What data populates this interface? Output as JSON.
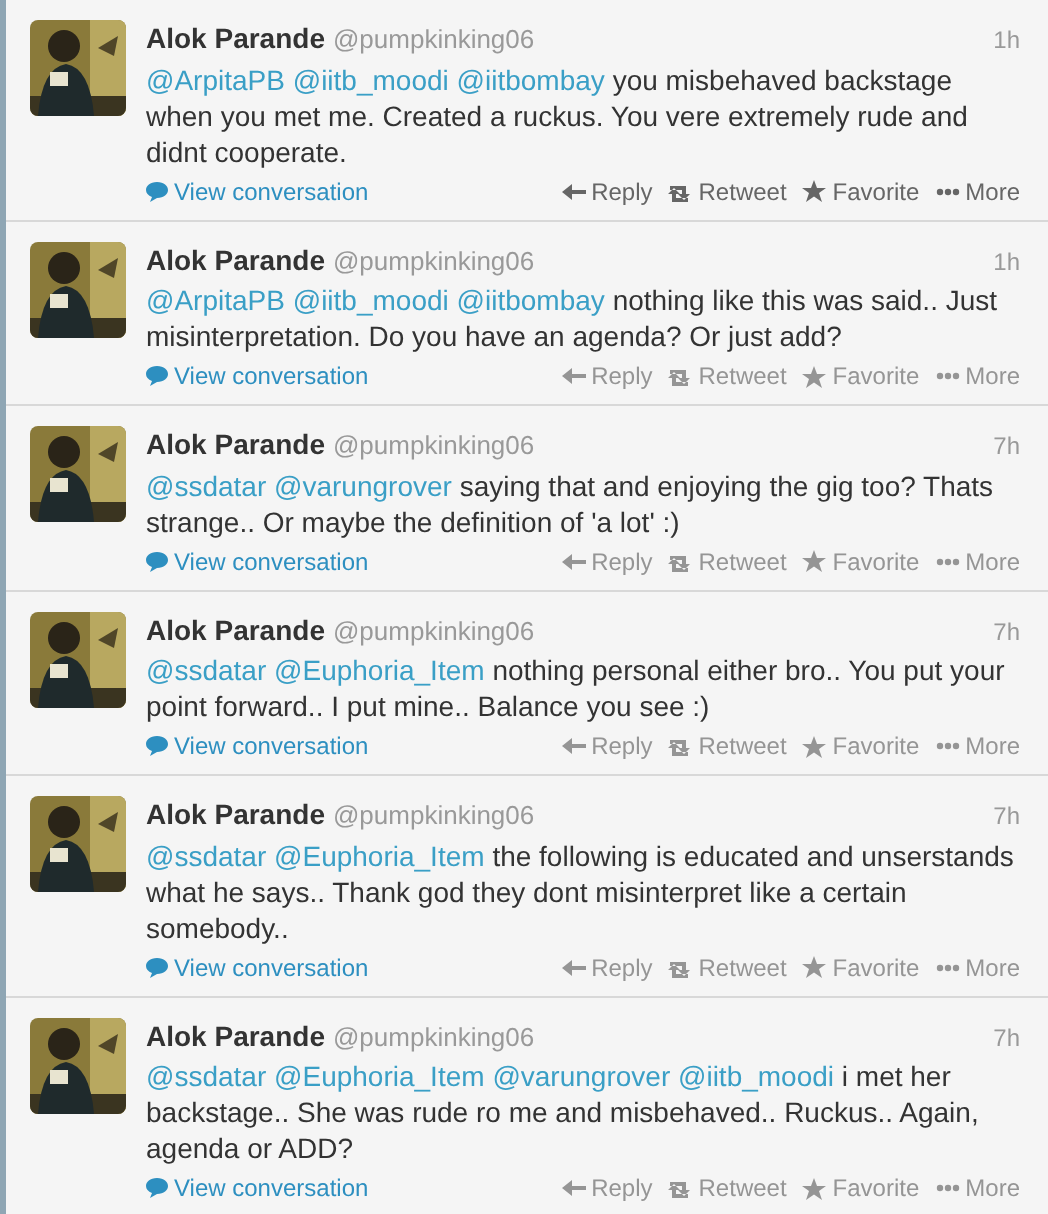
{
  "tweets": [
    {
      "name": "Alok Parande",
      "handle": "@pumpkinking06",
      "time": "1h",
      "mentions": [
        "@ArpitaPB",
        "@iitb_moodi",
        "@iitbombay"
      ],
      "text": "you misbehaved backstage when you met me. Created a ruckus. You vere extremely rude and didnt cooperate.",
      "conversation": "View conversation",
      "actions": [
        "Reply",
        "Retweet",
        "Favorite",
        "More"
      ],
      "hovered": true
    },
    {
      "name": "Alok Parande",
      "handle": "@pumpkinking06",
      "time": "1h",
      "mentions": [
        "@ArpitaPB",
        "@iitb_moodi",
        "@iitbombay"
      ],
      "text": "nothing like this was said.. Just misinterpretation. Do you have an agenda? Or just add?",
      "conversation": "View conversation",
      "actions": [
        "Reply",
        "Retweet",
        "Favorite",
        "More"
      ],
      "hovered": false
    },
    {
      "name": "Alok Parande",
      "handle": "@pumpkinking06",
      "time": "7h",
      "mentions": [
        "@ssdatar",
        "@varungrover"
      ],
      "text": "saying that and enjoying the gig too? Thats strange.. Or maybe the definition of 'a lot' :)",
      "conversation": "View conversation",
      "actions": [
        "Reply",
        "Retweet",
        "Favorite",
        "More"
      ],
      "hovered": false
    },
    {
      "name": "Alok Parande",
      "handle": "@pumpkinking06",
      "time": "7h",
      "mentions": [
        "@ssdatar",
        "@Euphoria_Item"
      ],
      "text": "nothing personal either bro.. You put your point forward.. I put mine.. Balance you see :)",
      "conversation": "View conversation",
      "actions": [
        "Reply",
        "Retweet",
        "Favorite",
        "More"
      ],
      "hovered": false
    },
    {
      "name": "Alok Parande",
      "handle": "@pumpkinking06",
      "time": "7h",
      "mentions": [
        "@ssdatar",
        "@Euphoria_Item"
      ],
      "text": "the following is educated and unserstands what he says.. Thank god they dont misinterpret like a certain somebody..",
      "conversation": "View conversation",
      "actions": [
        "Reply",
        "Retweet",
        "Favorite",
        "More"
      ],
      "hovered": false
    },
    {
      "name": "Alok Parande",
      "handle": "@pumpkinking06",
      "time": "7h",
      "mentions": [
        "@ssdatar",
        "@Euphoria_Item",
        "@varungrover",
        "@iitb_moodi"
      ],
      "text": "i met her backstage.. She was rude ro me and misbehaved.. Ruckus.. Again, agenda or ADD?",
      "conversation": "View conversation",
      "actions": [
        "Reply",
        "Retweet",
        "Favorite",
        "More"
      ],
      "hovered": false
    }
  ]
}
